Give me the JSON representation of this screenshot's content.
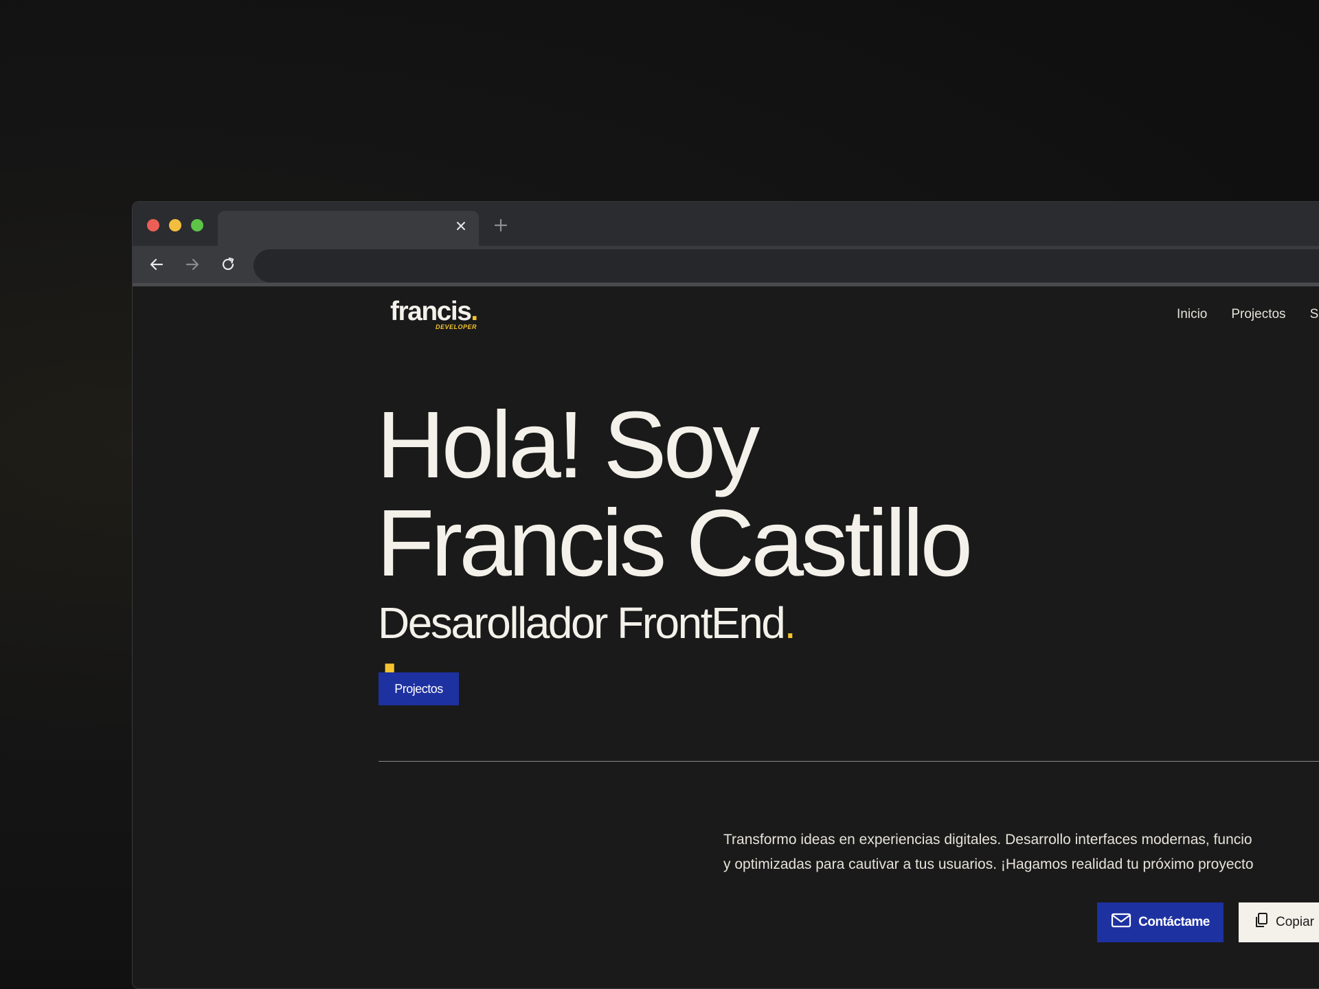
{
  "browser": {
    "address_value": "",
    "colors": {
      "close": "#ec5f56",
      "minimize": "#f3bd3f",
      "maximize": "#5ec448",
      "chrome": "#2b2c2f"
    }
  },
  "site": {
    "logo": {
      "word": "francis",
      "dot": ".",
      "sub": "DEVELOPER"
    },
    "nav": [
      "Inicio",
      "Projectos",
      "S"
    ],
    "hero": {
      "line1": "Hola! Soy",
      "line2": "Francis Castillo",
      "dot": ".",
      "subtitle": "Desarollador FrontEnd",
      "subtitle_dot": "."
    },
    "projects_button": "Projectos",
    "intro": {
      "line1": "Transformo ideas en experiencias digitales. Desarrollo interfaces modernas, funcio",
      "line2": "y optimizadas para cautivar a tus usuarios. ¡Hagamos realidad tu próximo proyecto"
    },
    "contact_button": "Contáctame",
    "copy_button": "Copiar",
    "icons": {
      "contact": "mail-icon",
      "copy": "copy-icon"
    },
    "colors": {
      "accent": "#f4c430",
      "button_blue": "#1e31a0",
      "text": "#f3f1ea",
      "background": "#1a1a1a"
    }
  }
}
